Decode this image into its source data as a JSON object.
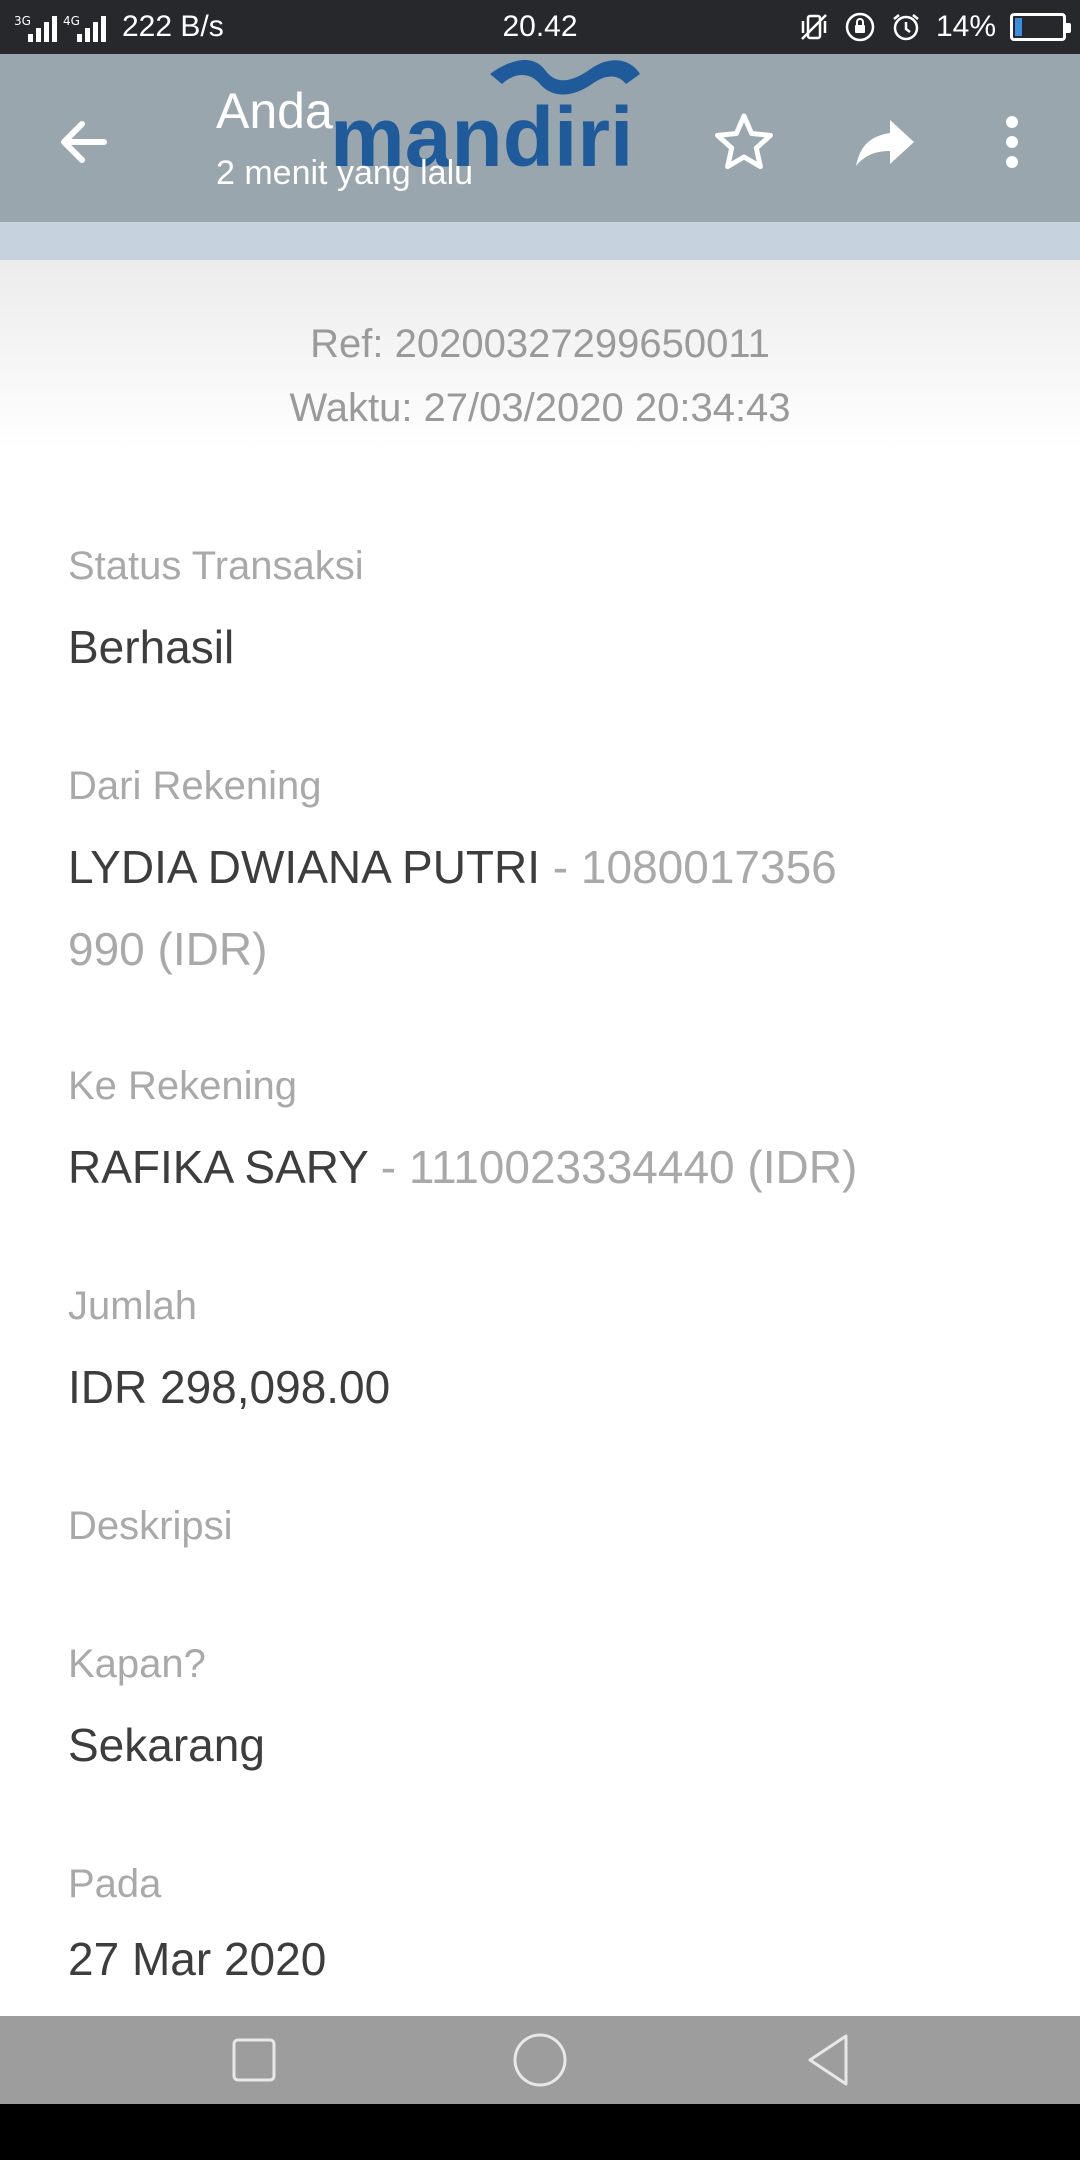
{
  "status_bar": {
    "sim1_tag": "3G",
    "sim2_tag": "4G",
    "speed": "222 B/s",
    "time": "20.42",
    "battery": "14%",
    "battery_level": 0.14
  },
  "app_bar": {
    "title": "Anda",
    "subtitle": "2 menit yang lalu",
    "logo_text": "mandiri",
    "brand_color": "#1f5b9a",
    "icons": [
      "back-arrow-icon",
      "star-icon",
      "share-icon",
      "more-vert-icon"
    ]
  },
  "header": {
    "ref": "Ref: 20200327299650011",
    "waktu": "Waktu: 27/03/2020 20:34:43"
  },
  "details": {
    "status_label": "Status Transaksi",
    "status_value": "Berhasil",
    "from_label": "Dari Rekening",
    "from_name": "LYDIA DWIANA PUTRI",
    "from_account_line1": " - 1080017356",
    "from_account_line2": "990 (IDR)",
    "to_label": "Ke Rekening",
    "to_name": "RAFIKA SARY",
    "to_account": " - 1110023334440 (IDR)",
    "amount_label": "Jumlah",
    "amount_value": "IDR 298,098.00",
    "desc_label": "Deskripsi",
    "when_label": "Kapan?",
    "when_value": "Sekarang",
    "on_label": "Pada",
    "on_value": "27 Mar 2020"
  },
  "nav_bar": {
    "icons": [
      "recents-square-icon",
      "home-circle-icon",
      "back-triangle-icon"
    ]
  }
}
